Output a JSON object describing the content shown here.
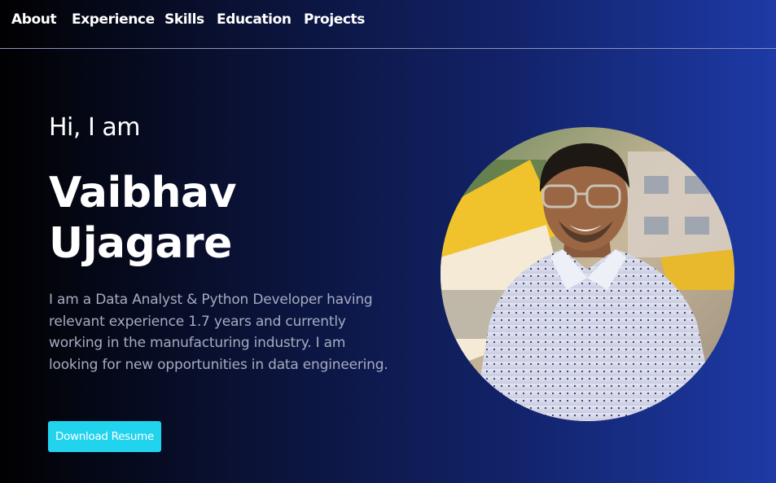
{
  "nav": {
    "items": [
      {
        "label": "About"
      },
      {
        "label": "Experience"
      },
      {
        "label": "Skills"
      },
      {
        "label": "Education"
      },
      {
        "label": "Projects"
      }
    ]
  },
  "hero": {
    "greeting": "Hi, I am",
    "name_first": "Vaibhav",
    "name_last": "Ujagare",
    "bio": "I am a Data Analyst & Python Developer having relevant experience 1.7 years and currently working in the manufacturing industry. I am looking for new opportunities in data engineering.",
    "resume_button": "Download Resume"
  },
  "avatar": {
    "icon": "profile-photo"
  },
  "colors": {
    "accent": "#22d3ee",
    "bio_text": "#a5acc0",
    "bg_left": "#010102",
    "bg_right": "#1d3aa6"
  }
}
